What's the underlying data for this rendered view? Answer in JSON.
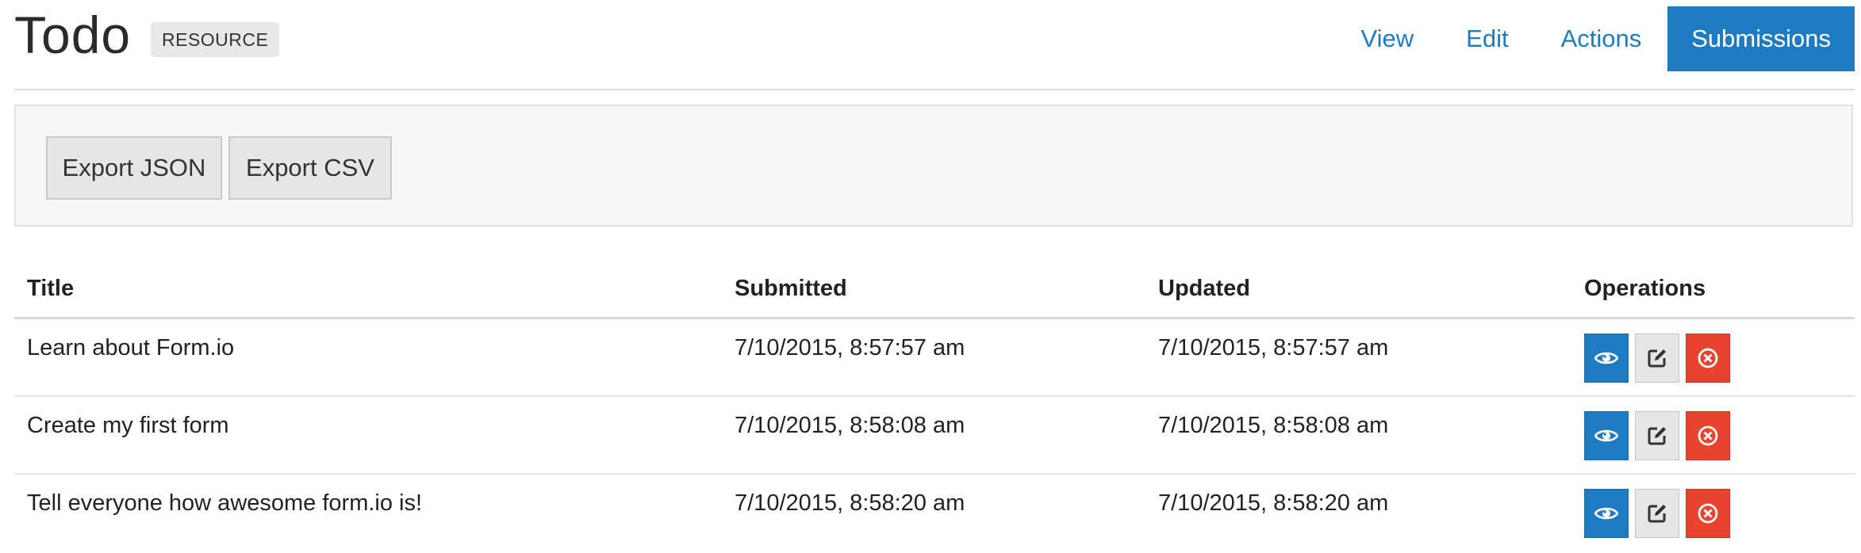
{
  "header": {
    "title": "Todo",
    "badge": "RESOURCE",
    "nav": [
      {
        "label": "View"
      },
      {
        "label": "Edit"
      },
      {
        "label": "Actions"
      },
      {
        "label": "Submissions",
        "active": true
      }
    ]
  },
  "toolbar": {
    "export_json": "Export JSON",
    "export_csv": "Export CSV"
  },
  "table": {
    "columns": [
      "Title",
      "Submitted",
      "Updated",
      "Operations"
    ],
    "rows": [
      {
        "title": "Learn about Form.io",
        "submitted": "7/10/2015, 8:57:57 am",
        "updated": "7/10/2015, 8:57:57 am"
      },
      {
        "title": "Create my first form",
        "submitted": "7/10/2015, 8:58:08 am",
        "updated": "7/10/2015, 8:58:08 am"
      },
      {
        "title": "Tell everyone how awesome form.io is!",
        "submitted": "7/10/2015, 8:58:20 am",
        "updated": "7/10/2015, 8:58:20 am"
      }
    ],
    "operations": [
      {
        "name": "view",
        "icon": "eye-icon"
      },
      {
        "name": "edit",
        "icon": "edit-icon"
      },
      {
        "name": "delete",
        "icon": "remove-circle-icon"
      }
    ]
  },
  "colors": {
    "primary": "#1f7bc1",
    "danger": "#e8432f",
    "default": "#e6e6e6"
  }
}
